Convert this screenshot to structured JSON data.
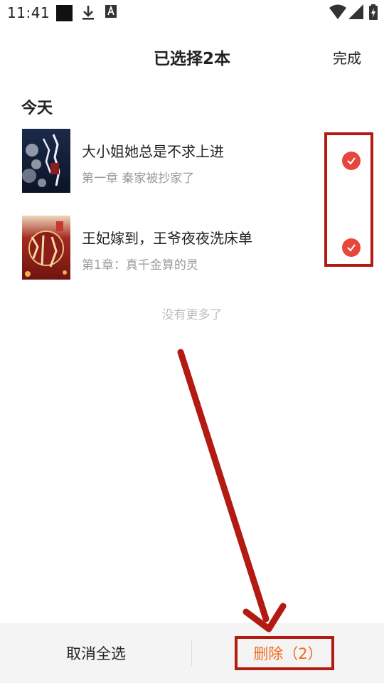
{
  "status_bar": {
    "time": "11:41",
    "icons": [
      "notification-square-icon",
      "download-icon",
      "font-a-icon"
    ],
    "right_icons": [
      "wifi-icon",
      "signal-icon",
      "battery-charging-icon"
    ]
  },
  "header": {
    "title": "已选择2本",
    "done_label": "完成"
  },
  "section": {
    "title": "今天"
  },
  "books": [
    {
      "title": "大小姐她总是不求上进",
      "chapter": "第一章 秦家被抄家了",
      "selected": true
    },
    {
      "title": "王妃嫁到，王爷夜夜洗床单",
      "chapter": "第1章：真千金算的灵",
      "selected": true
    }
  ],
  "list_footer": "没有更多了",
  "bottom_bar": {
    "cancel_label": "取消全选",
    "delete_label": "删除（2）"
  },
  "colors": {
    "accent": "#e8453c",
    "delete_text": "#f06a1e",
    "annotation": "#b31b12"
  }
}
